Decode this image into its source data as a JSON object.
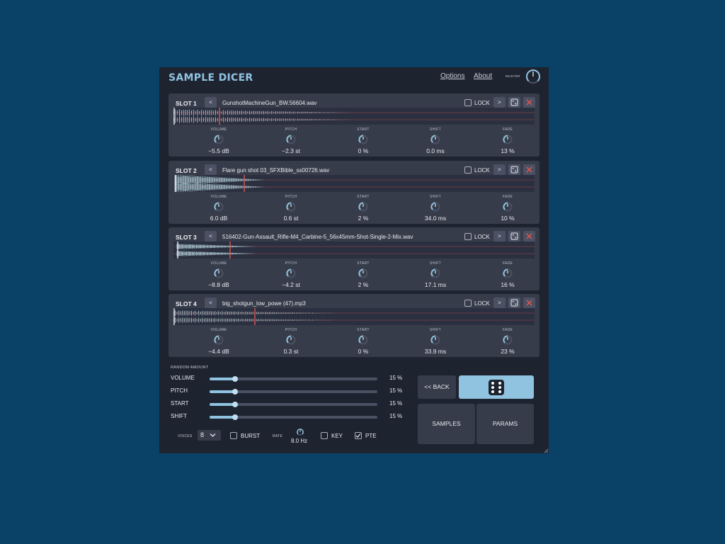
{
  "app": {
    "title": "SAMPLE DICER",
    "options_label": "Options",
    "about_label": "About",
    "master_label": "MASTER"
  },
  "slots": [
    {
      "label": "SLOT 1",
      "file": "GunshotMachineGun_BW.56604.wav",
      "lock_label": "LOCK",
      "params": [
        {
          "label": "VOLUME",
          "value": "−5.5 dB"
        },
        {
          "label": "PITCH",
          "value": "−2.3 st"
        },
        {
          "label": "START",
          "value": "0 %"
        },
        {
          "label": "SHIFT",
          "value": "0.0 ms"
        },
        {
          "label": "FADE",
          "value": "13 %"
        }
      ]
    },
    {
      "label": "SLOT 2",
      "file": "Flare gun shot 03_SFXBible_ss00726.wav",
      "lock_label": "LOCK",
      "params": [
        {
          "label": "VOLUME",
          "value": "6.0 dB"
        },
        {
          "label": "PITCH",
          "value": "0.6 st"
        },
        {
          "label": "START",
          "value": "2 %"
        },
        {
          "label": "SHIFT",
          "value": "34.0 ms"
        },
        {
          "label": "FADE",
          "value": "10 %"
        }
      ]
    },
    {
      "label": "SLOT 3",
      "file": "516402-Gun-Assault_Rifle-M4_Carbine-5_56x45mm-Shot-Single-2-Mix.wav",
      "lock_label": "LOCK",
      "params": [
        {
          "label": "VOLUME",
          "value": "−8.8 dB"
        },
        {
          "label": "PITCH",
          "value": "−4.2 st"
        },
        {
          "label": "START",
          "value": "2 %"
        },
        {
          "label": "SHIFT",
          "value": "17.1 ms"
        },
        {
          "label": "FADE",
          "value": "16 %"
        }
      ]
    },
    {
      "label": "SLOT 4",
      "file": "big_shotgun_low_powe (47).mp3",
      "lock_label": "LOCK",
      "params": [
        {
          "label": "VOLUME",
          "value": "−4.4 dB"
        },
        {
          "label": "PITCH",
          "value": "0.3 st"
        },
        {
          "label": "START",
          "value": "0 %"
        },
        {
          "label": "SHIFT",
          "value": "33.9 ms"
        },
        {
          "label": "FADE",
          "value": "23 %"
        }
      ]
    }
  ],
  "nav": {
    "prev": "<",
    "next": ">"
  },
  "random": {
    "title": "RANDOM AMOUNT",
    "sliders": [
      {
        "label": "VOLUME",
        "value": "15 %",
        "fraction": 0.15
      },
      {
        "label": "PITCH",
        "value": "15 %",
        "fraction": 0.15
      },
      {
        "label": "START",
        "value": "15 %",
        "fraction": 0.15
      },
      {
        "label": "SHIFT",
        "value": "15 %",
        "fraction": 0.15
      }
    ]
  },
  "bottom": {
    "voices_label": "VOICES",
    "voices_value": "8",
    "burst_label": "BURST",
    "rate_label": "RATE",
    "rate_value": "8.0 Hz",
    "key_label": "KEY",
    "pte_label": "PTE",
    "pte_checked": true
  },
  "buttons": {
    "back": "<< BACK",
    "samples": "SAMPLES",
    "params": "PARAMS"
  },
  "colors": {
    "accent": "#8fc3e0",
    "background": "#1e2330",
    "panel": "#373c4a",
    "desktop": "#0a4166",
    "marker": "#e0554f"
  },
  "icons": {
    "dice": "dice-icon",
    "close": "close-icon",
    "randomize": "dice-small-icon"
  }
}
